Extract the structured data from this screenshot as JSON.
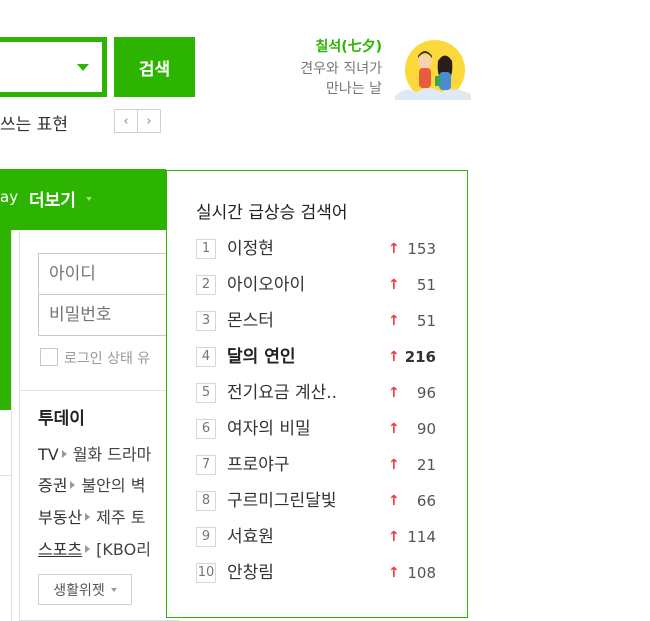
{
  "search": {
    "button_label": "검색"
  },
  "phrase": {
    "text": "쓰는 표현"
  },
  "pager": {
    "prev": "‹",
    "next": "›"
  },
  "promo": {
    "title": "칠석(七夕)",
    "line1": "견우와 직녀가",
    "line2": "만나는 날"
  },
  "nav": {
    "day_label": "ay",
    "more_label": "더보기"
  },
  "login": {
    "id_placeholder": "아이디",
    "pw_placeholder": "비밀번호",
    "keep_label": "로그인 상태 유"
  },
  "today": {
    "title": "투데이",
    "rows": [
      {
        "category": "TV",
        "text": "월화 드라마"
      },
      {
        "category": "증권",
        "text": "불안의 벽"
      },
      {
        "category": "부동산",
        "text": "제주 토"
      },
      {
        "category": "스포츠",
        "text": "[KBO리"
      }
    ],
    "widget_label": "생활위젯"
  },
  "realtime": {
    "title": "실시간 급상승 검색어",
    "arrow": "↑",
    "items": [
      {
        "rank": "1",
        "keyword": "이정현",
        "count": "153"
      },
      {
        "rank": "2",
        "keyword": "아이오아이",
        "count": "51"
      },
      {
        "rank": "3",
        "keyword": "몬스터",
        "count": "51"
      },
      {
        "rank": "4",
        "keyword": "달의 연인",
        "count": "216"
      },
      {
        "rank": "5",
        "keyword": "전기요금 계산..",
        "count": "96"
      },
      {
        "rank": "6",
        "keyword": "여자의 비밀",
        "count": "90"
      },
      {
        "rank": "7",
        "keyword": "프로야구",
        "count": "21"
      },
      {
        "rank": "8",
        "keyword": "구르미그린달빛",
        "count": "66"
      },
      {
        "rank": "9",
        "keyword": "서효원",
        "count": "114"
      },
      {
        "rank": "10",
        "keyword": "안창림",
        "count": "108"
      }
    ]
  },
  "colors": {
    "brand_green": "#2db400",
    "rise_red": "#f23c3c"
  }
}
